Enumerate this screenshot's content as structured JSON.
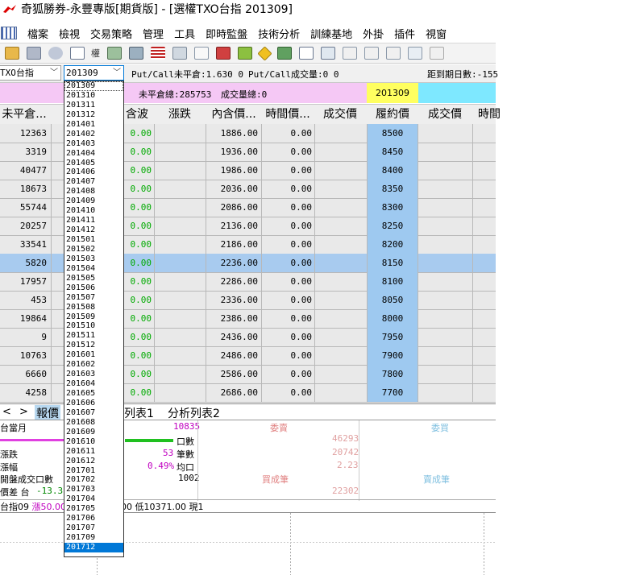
{
  "window": {
    "title": "奇狐勝券-永豐專版[期貨版] - [選權TXO台指 201309]"
  },
  "menu": [
    "檔案",
    "檢視",
    "交易策略",
    "管理",
    "工具",
    "即時監盤",
    "技術分析",
    "訓練基地",
    "外掛",
    "插件",
    "視窗"
  ],
  "toolbar": {
    "quote_label": "權"
  },
  "selectors": {
    "product": "TXO台指",
    "month": "201309"
  },
  "info": {
    "pc_oi": "Put/Call未平倉:1.630 0",
    "pc_vol": "Put/Call成交量:0 0",
    "days_left": "距到期日數:-155",
    "oi_total": "未平倉總:285753",
    "vol_total": "成交量總:0",
    "month_cell": "201309"
  },
  "columns": [
    "未平倉...",
    "",
    "含波",
    "漲跌",
    "內含價...",
    "時間價...",
    "成交價",
    "履約價",
    "成交價",
    "時間"
  ],
  "rows": [
    {
      "oi": "12363",
      "chg": "0.00",
      "intrinsic": "1886.00",
      "time": "0.00",
      "strike": "8500"
    },
    {
      "oi": "3319",
      "chg": "0.00",
      "intrinsic": "1936.00",
      "time": "0.00",
      "strike": "8450"
    },
    {
      "oi": "40477",
      "chg": "0.00",
      "intrinsic": "1986.00",
      "time": "0.00",
      "strike": "8400"
    },
    {
      "oi": "18673",
      "chg": "0.00",
      "intrinsic": "2036.00",
      "time": "0.00",
      "strike": "8350"
    },
    {
      "oi": "55744",
      "chg": "0.00",
      "intrinsic": "2086.00",
      "time": "0.00",
      "strike": "8300"
    },
    {
      "oi": "20257",
      "chg": "0.00",
      "intrinsic": "2136.00",
      "time": "0.00",
      "strike": "8250"
    },
    {
      "oi": "33541",
      "chg": "0.00",
      "intrinsic": "2186.00",
      "time": "0.00",
      "strike": "8200"
    },
    {
      "oi": "5820",
      "chg": "0.00",
      "intrinsic": "2236.00",
      "time": "0.00",
      "strike": "8150"
    },
    {
      "oi": "17957",
      "chg": "0.00",
      "intrinsic": "2286.00",
      "time": "0.00",
      "strike": "8100"
    },
    {
      "oi": "453",
      "chg": "0.00",
      "intrinsic": "2336.00",
      "time": "0.00",
      "strike": "8050"
    },
    {
      "oi": "19864",
      "chg": "0.00",
      "intrinsic": "2386.00",
      "time": "0.00",
      "strike": "8000"
    },
    {
      "oi": "9",
      "chg": "0.00",
      "intrinsic": "2436.00",
      "time": "0.00",
      "strike": "7950"
    },
    {
      "oi": "10763",
      "chg": "0.00",
      "intrinsic": "2486.00",
      "time": "0.00",
      "strike": "7900"
    },
    {
      "oi": "6660",
      "chg": "0.00",
      "intrinsic": "2586.00",
      "time": "0.00",
      "strike": "7800"
    },
    {
      "oi": "4258",
      "chg": "0.00",
      "intrinsic": "2686.00",
      "time": "0.00",
      "strike": "7700"
    }
  ],
  "tabs": [
    "報價",
    "列表1",
    "分析列表2"
  ],
  "bottom": {
    "label_month": "台當月",
    "val_10835": "10835",
    "label_lots": "口數",
    "val_53": "53",
    "label_count": "筆數",
    "val_pct": "0.49%",
    "label_avg": "均口",
    "val_1002": "1002",
    "label_chg": "漲跌",
    "label_amp": "漲幅",
    "label_open_vol": "開盤成交口數",
    "label_spread": "價差 台",
    "val_spread": "-13.3",
    "label_sell": "委賣",
    "label_buy": "委買",
    "label_buy_done": "買成筆",
    "label_sell_done": "賣成筆",
    "red_46293": "46293",
    "red_20742": "20742",
    "red_223": "2.23",
    "red_22302": "22302",
    "status_prefix": "台指09",
    "status_up": "漲50.00",
    "status_rest": "432.00 低10371.00 現1"
  },
  "dropdown": [
    "201309",
    "201310",
    "201311",
    "201312",
    "201401",
    "201402",
    "201403",
    "201404",
    "201405",
    "201406",
    "201407",
    "201408",
    "201409",
    "201410",
    "201411",
    "201412",
    "201501",
    "201502",
    "201503",
    "201504",
    "201505",
    "201506",
    "201507",
    "201508",
    "201509",
    "201510",
    "201511",
    "201512",
    "201601",
    "201602",
    "201603",
    "201604",
    "201605",
    "201606",
    "201607",
    "201608",
    "201609",
    "201610",
    "201611",
    "201612",
    "201701",
    "201702",
    "201703",
    "201704",
    "201705",
    "201706",
    "201707",
    "201709",
    "201712"
  ],
  "dropdown_selected": "201712",
  "colors": {
    "pink": "#f5c8f5",
    "yellow": "#ffff60",
    "cyan": "#7ee8ff",
    "green": "#00aa00",
    "highlight": "#a8cbef",
    "select": "#0078d7"
  }
}
